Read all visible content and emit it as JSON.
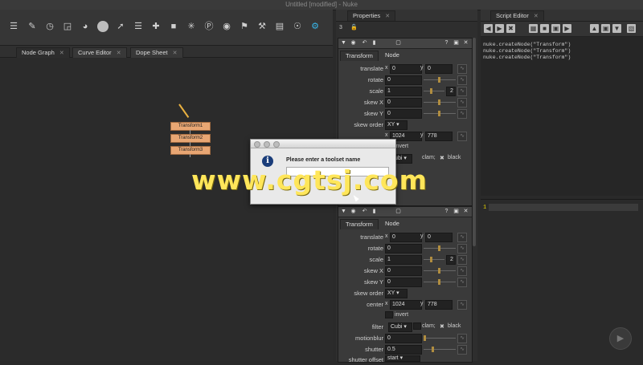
{
  "window": {
    "title": "Untitled [modified] - Nuke"
  },
  "toolbar": {
    "icons": [
      "toolsets-icon",
      "draw-icon",
      "time-icon",
      "channel-icon",
      "color-icon",
      "filter-icon",
      "keyer-icon",
      "merge-icon",
      "transform-icon",
      "3d-icon",
      "particles-icon",
      "deep-icon",
      "views-icon",
      "metadata-icon",
      "toolsets-icon-2",
      "other-icon",
      "furnace-icon",
      "settings-icon"
    ]
  },
  "node_graph_tabs": [
    {
      "label": "Node Graph"
    },
    {
      "label": "Curve Editor"
    },
    {
      "label": "Dope Sheet"
    }
  ],
  "nodes": [
    "Transform1",
    "Transform2",
    "Transform3"
  ],
  "properties": {
    "title": "Properties",
    "count": "3",
    "panel_tabs": [
      "Transform",
      "Node"
    ],
    "panel1": {
      "translate_label": "translate",
      "translate_x": "0",
      "translate_y": "0",
      "rotate_label": "rotate",
      "rotate": "0",
      "scale_label": "scale",
      "scale": "1",
      "scale_btn": "2",
      "skewx_label": "skew X",
      "skewx": "0",
      "skewy_label": "skew Y",
      "skewy": "0",
      "skew_order_label": "skew order",
      "skew_order": "XY",
      "center_label": "center",
      "center_x": "1024",
      "center_y": "778",
      "invert_label": "invert",
      "filter_value": "Cubi",
      "clamp_label": "clam;",
      "black_label": "black"
    },
    "panel2": {
      "translate_label": "translate",
      "translate_x": "0",
      "translate_y": "0",
      "rotate_label": "rotate",
      "rotate": "0",
      "scale_label": "scale",
      "scale": "1",
      "scale_btn": "2",
      "skewx_label": "skew X",
      "skewx": "0",
      "skewy_label": "skew Y",
      "skewy": "0",
      "skew_order_label": "skew order",
      "skew_order": "XY",
      "center_label": "center",
      "center_x": "1024",
      "center_y": "778",
      "invert_label": "invert",
      "filter_label": "filter",
      "filter_value": "Cubi",
      "clamp_label": "clam;",
      "black_label": "black",
      "motionblur_label": "motionblur",
      "motionblur": "0",
      "shutter_label": "shutter",
      "shutter": "0.5",
      "shutter_offset_label": "shutter offset",
      "shutter_offset": "start"
    }
  },
  "script_editor": {
    "title": "Script Editor",
    "output_lines": [
      "nuke.createNode(\"Transform\")",
      "nuke.createNode(\"Transform\")",
      "nuke.createNode(\"Transform\")"
    ],
    "input_line_number": "1"
  },
  "dialog": {
    "message": "Please enter a toolset name",
    "input_value": ""
  },
  "watermark": "www.cgtsj.com",
  "colors": {
    "node_fill": "#e8a673",
    "accent_blue": "#38b6e8",
    "watermark": "#ffe65a"
  }
}
